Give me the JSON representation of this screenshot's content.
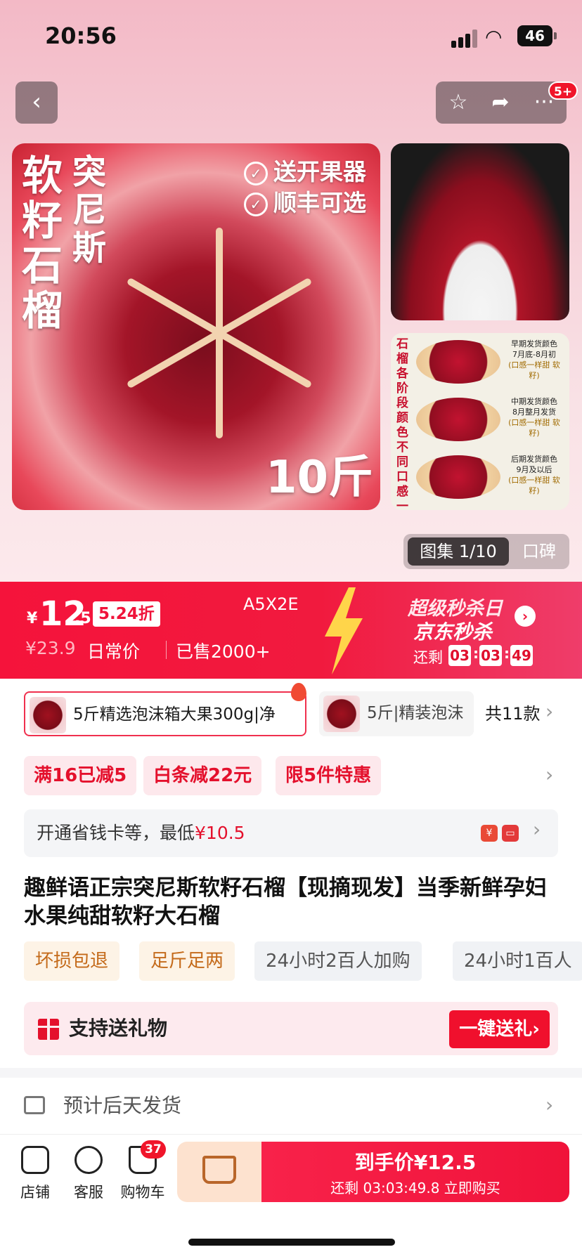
{
  "status": {
    "time": "20:56",
    "battery": "46"
  },
  "nav": {
    "back_icon": "chevron-left-icon",
    "cart_badge": "5+"
  },
  "gallery_main": {
    "title": "软籽石榴",
    "subtitle": "突尼斯",
    "tags": [
      "送开果器",
      "顺丰可选"
    ],
    "weight": "10斤"
  },
  "gallery_side2": {
    "vertical_text": "石榴各阶段颜色不同口感一样纯甜",
    "rows": [
      {
        "l1": "早期发货颜色",
        "l2": "7月底-8月初",
        "l3": "(口感一样甜 软籽)"
      },
      {
        "l1": "中期发货颜色",
        "l2": "8月整月发货",
        "l3": "(口感一样甜 软籽)"
      },
      {
        "l1": "后期发货颜色",
        "l2": "9月及以后",
        "l3": "(口感一样甜 软籽)"
      }
    ]
  },
  "gallery_switch": {
    "album": "图集 1/10",
    "reviews": "口碑"
  },
  "price": {
    "yen": "¥",
    "integer": "12",
    "decimal": ".5",
    "discount": "5.24折",
    "code": "A5X2E",
    "original": "¥23.9",
    "daily_label": "日常价",
    "sold": "已售2000+"
  },
  "flash": {
    "line1": "超级秒杀日",
    "line2": "京东秒杀",
    "countdown_label": "还剩",
    "h": "03",
    "m": "03",
    "s": "49"
  },
  "variants": {
    "v1": "5斤精选泡沫箱大果300g|净",
    "v2": "5斤|精装泡沫",
    "count": "共11款"
  },
  "coupons": [
    "满16已减5",
    "白条减22元",
    "限5件特惠"
  ],
  "savings": {
    "text": "开通省钱卡等，最低",
    "price": "¥10.5"
  },
  "title": "趣鲜语正宗突尼斯软籽石榴【现摘现发】当季新鲜孕妇水果纯甜软籽大石榴",
  "tags": [
    "坏损包退",
    "足斤足两",
    "24小时2百人加购",
    "24小时1百人"
  ],
  "gift": {
    "label": "支持送礼物",
    "button": "一键送礼›"
  },
  "shipping": {
    "label": "预计后天发货"
  },
  "footer": {
    "store": "店铺",
    "service": "客服",
    "cart": "购物车",
    "cart_count": "37",
    "buy_line1": "到手价¥12.5",
    "buy_line2": "还剩 03:03:49.8 立即购买"
  },
  "colors": {
    "brand_red": "#f0133a",
    "coupon_bg": "#fde8ec",
    "bg_top": "#f3b9c6"
  }
}
